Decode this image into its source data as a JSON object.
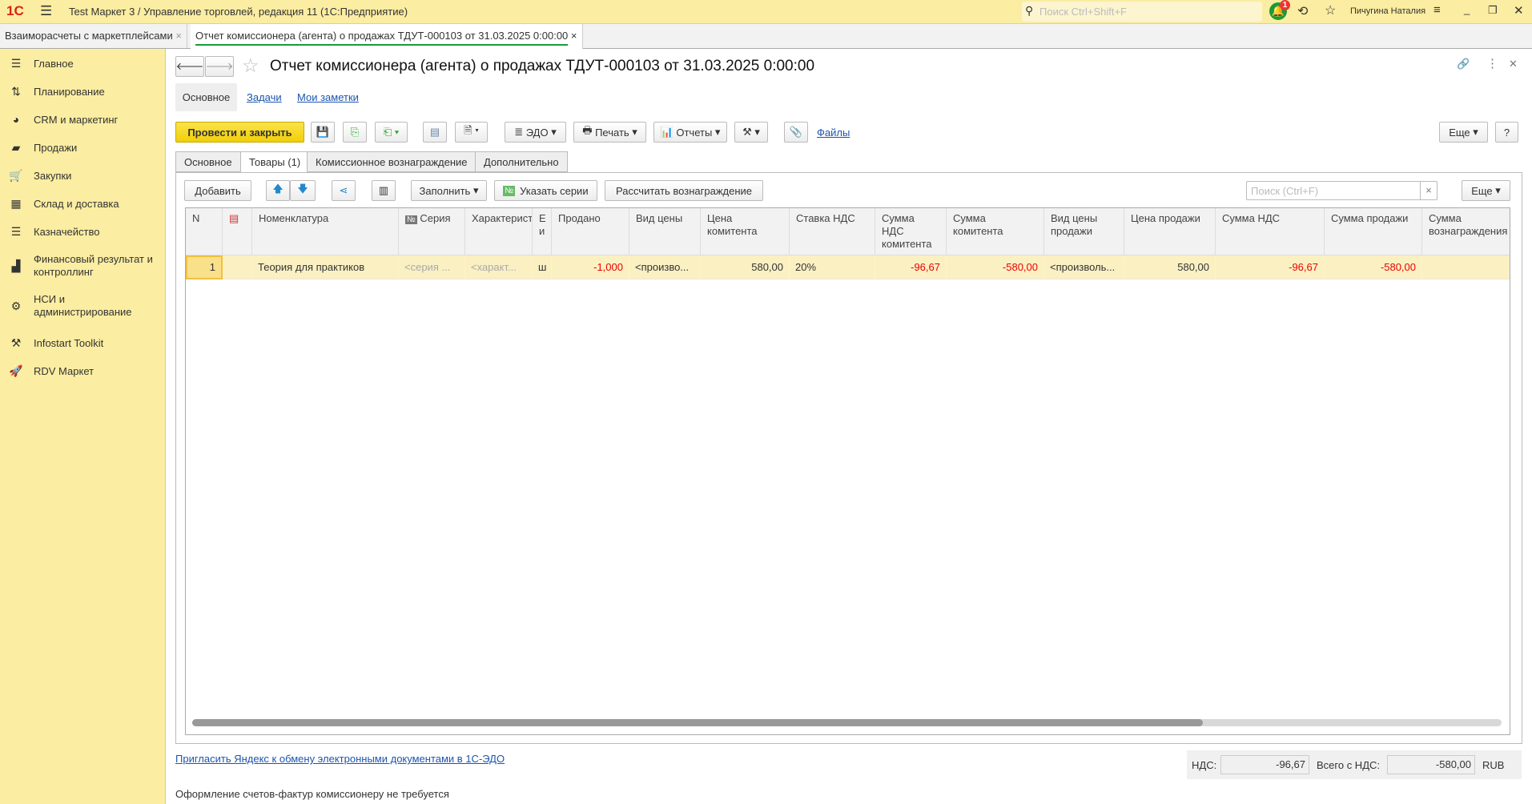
{
  "app": {
    "title": "Test Маркет 3 / Управление торговлей, редакция 11  (1С:Предприятие)",
    "search_placeholder": "Поиск Ctrl+Shift+F",
    "notifications": "1",
    "user": "Пичугина Наталия"
  },
  "window_tabs": [
    {
      "label": "Взаиморасчеты с маркетплейсами"
    },
    {
      "label": "Отчет комиссионера (агента) о продажах ТДУТ-000103 от 31.03.2025 0:00:00"
    }
  ],
  "sidebar": {
    "items": [
      {
        "label": "Главное",
        "icon": "menu-icon"
      },
      {
        "label": "Планирование",
        "icon": "planning-icon"
      },
      {
        "label": "CRM и маркетинг",
        "icon": "pie-chart-icon"
      },
      {
        "label": "Продажи",
        "icon": "bag-icon"
      },
      {
        "label": "Закупки",
        "icon": "cart-icon"
      },
      {
        "label": "Склад и доставка",
        "icon": "warehouse-icon"
      },
      {
        "label": "Казначейство",
        "icon": "coins-icon"
      },
      {
        "label": "Финансовый результат и контроллинг",
        "icon": "bar-chart-icon"
      },
      {
        "label": "НСИ и администрирование",
        "icon": "gear-icon"
      },
      {
        "label": "Infostart Toolkit",
        "icon": "tools-icon"
      },
      {
        "label": "RDV Маркет",
        "icon": "rocket-icon"
      }
    ]
  },
  "document": {
    "title": "Отчет комиссионера (агента) о продажах ТДУТ-000103 от 31.03.2025 0:00:00",
    "nav_tabs": [
      "Основное",
      "Задачи",
      "Мои заметки"
    ]
  },
  "toolbar": {
    "post_close": "Провести и закрыть",
    "edo": "ЭДО",
    "print": "Печать",
    "reports": "Отчеты",
    "files": "Файлы",
    "more": "Еще",
    "help": "?"
  },
  "page_tabs": [
    "Основное",
    "Товары (1)",
    "Комиссионное вознаграждение",
    "Дополнительно"
  ],
  "table_toolbar": {
    "add": "Добавить",
    "fill": "Заполнить",
    "series": "Указать серии",
    "calc": "Рассчитать вознаграждение",
    "search_placeholder": "Поиск (Ctrl+F)",
    "more": "Еще"
  },
  "table": {
    "columns": [
      "N",
      "",
      "Номенклатура",
      "Серия",
      "Характеристика",
      "Е и",
      "Продано",
      "Вид цены",
      "Цена комитента",
      "Ставка НДС",
      "Сумма НДС комитента",
      "Сумма комитента",
      "Вид цены продажи",
      "Цена продажи",
      "Сумма НДС",
      "Сумма продажи",
      "Сумма вознаграждения"
    ],
    "rows": [
      [
        "1",
        "",
        "Теория для практиков",
        "<серия ...",
        "<характ...",
        "ш",
        "-1,000",
        "<произво...",
        "580,00",
        "20%",
        "-96,67",
        "-580,00",
        "<произволь...",
        "580,00",
        "-96,67",
        "-580,00",
        ""
      ]
    ]
  },
  "footer": {
    "edo_link": "Пригласить Яндекс к обмену электронными документами в 1С-ЭДО",
    "vat_label": "НДС:",
    "vat_value": "-96,67",
    "total_label": "Всего с НДС:",
    "total_value": "-580,00",
    "currency": "RUB",
    "note": "Оформление счетов-фактур комиссионеру не требуется"
  }
}
